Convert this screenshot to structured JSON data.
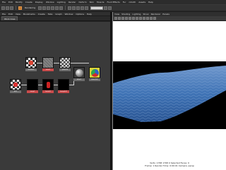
{
  "app_menu": [
    "File",
    "Edit",
    "Modify",
    "Create",
    "Display",
    "Window",
    "Lighting",
    "Render",
    "Deform",
    "Skin",
    "Muscle",
    "Fluid Effects",
    "Fur",
    "nCloth",
    "Assets",
    "Help"
  ],
  "toolbar": {
    "mode_label": "Rendering",
    "field_value": ""
  },
  "hypershade": {
    "menus": [
      "File",
      "Edit",
      "View",
      "Bookmarks",
      "Create",
      "Tabs",
      "Graph",
      "Window",
      "Options",
      "Help"
    ],
    "tab_label": "Work Area"
  },
  "nodes": [
    {
      "id": "checker",
      "label": "checker1"
    },
    {
      "id": "noise",
      "label": "noise1"
    },
    {
      "id": "grid",
      "label": "place2d"
    },
    {
      "id": "blinn",
      "label": "blinn1"
    },
    {
      "id": "sg",
      "label": "blinn1SG"
    },
    {
      "id": "tex1",
      "label": "file1"
    },
    {
      "id": "tex2",
      "label": "ramp1"
    },
    {
      "id": "tex3",
      "label": "fractal1"
    },
    {
      "id": "tex4",
      "label": "bump2d1"
    }
  ],
  "viewport": {
    "menus": [
      "View",
      "Shading",
      "Lighting",
      "Show",
      "Renderer",
      "Panels"
    ],
    "hud": {
      "line1": "Verts: 1768   1768   0   Selected Faces: 0",
      "line2": "Frame: 1      Render Time: 0:00:01   Camera: persp"
    }
  },
  "colors": {
    "ocean_blue": "#3f73b5",
    "node_label_red": "#c94b4b"
  }
}
